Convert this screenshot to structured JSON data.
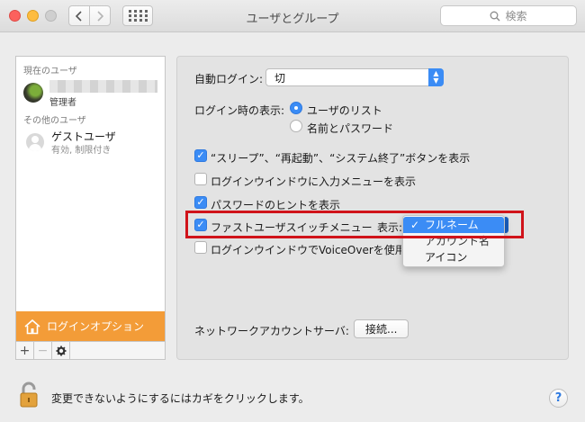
{
  "window": {
    "title": "ユーザとグループ",
    "search_placeholder": "検索"
  },
  "sidebar": {
    "current_user_section": "現在のユーザ",
    "current_user_role": "管理者",
    "other_users_section": "その他のユーザ",
    "guest_name": "ゲストユーザ",
    "guest_status": "有効, 制限付き",
    "login_options_label": "ログインオプション",
    "add_label": "+",
    "remove_label": "−",
    "gear_label": "✱"
  },
  "panel": {
    "auto_login_label": "自動ログイン:",
    "auto_login_value": "切",
    "login_display_label": "ログイン時の表示:",
    "radio_user_list": "ユーザのリスト",
    "radio_name_password": "名前とパスワード",
    "cb_sleep_restart": "“スリープ”、“再起動”、“システム終了”ボタンを表示",
    "cb_input_menu": "ログインウインドウに入力メニューを表示",
    "cb_password_hint": "パスワードのヒントを表示",
    "cb_fast_user_switch": "ファストユーザスイッチメニュー",
    "display_label": "表示:",
    "cb_voiceover": "ログインウインドウでVoiceOverを使用",
    "network_server_label": "ネットワークアカウントサーバ:",
    "connect_button": "接続..."
  },
  "dropdown": {
    "options": [
      "フルネーム",
      "アカウント名",
      "アイコン"
    ],
    "selected": "フルネーム",
    "check": "✓"
  },
  "footer": {
    "lock_text": "変更できないようにするにはカギをクリックします。",
    "help_label": "?"
  },
  "colors": {
    "accent": "#3b8cf5",
    "login_options_bg": "#f39c38",
    "highlight_border": "#d0131a"
  }
}
